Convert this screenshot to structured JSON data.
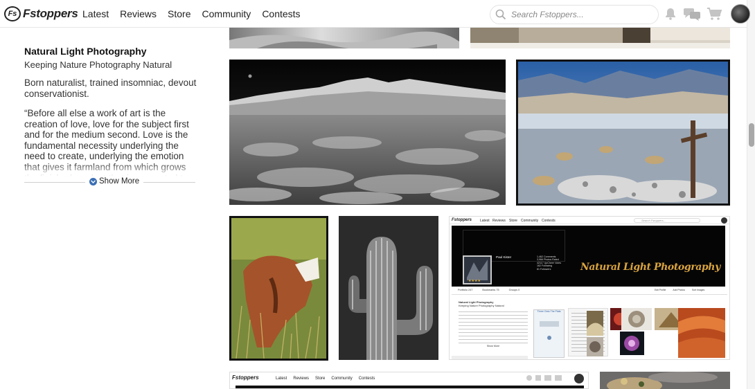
{
  "header": {
    "logo_mark": "Fs",
    "logo_text": "Fstoppers",
    "nav": [
      "Latest",
      "Reviews",
      "Store",
      "Community",
      "Contests"
    ],
    "search_placeholder": "Search Fstoppers..."
  },
  "profile": {
    "title": "Natural Light Photography",
    "subtitle": "Keeping Nature Photography Natural",
    "bio": "Born naturalist, trained insomniac, devout conservationist.",
    "quote": "“Before all else a work of art is the creation of love, love for the subject first and for the medium second. Love is the fundamental necessity underlying the need to create, underlying the emotion that gives it farmland from which grows the finished product that is presented to the world. Love is the",
    "show_more": "Show More"
  },
  "icons": {
    "bell": "bell-icon",
    "chat": "chat-icon",
    "cart": "cart-icon",
    "search": "search-icon"
  },
  "thumb_a": {
    "nav": [
      "Latest",
      "Reviews",
      "Store",
      "Community",
      "Contests"
    ],
    "search_placeholder": "Search Fstoppers...",
    "user": "Paul Kister",
    "stats": [
      "1,462 Comments",
      "3,966 Photos Rated",
      "42117 UpCheer Votes",
      "162 Following",
      "81 Followers"
    ],
    "banner": "Natural Light Photography",
    "tabs": [
      "Portfolio 247",
      "Bookmarks 75",
      "Groups 0"
    ],
    "actions": [
      "Edit Profile",
      "Add Photos",
      "Sort Images"
    ],
    "title": "Natural Light Photography",
    "subtitle": "Keeping Nature Photography Natural",
    "show_more": "Show More",
    "photo_caption": "Three Onto The Flats"
  },
  "thumb_b": {
    "nav": [
      "Latest",
      "Reviews",
      "Store",
      "Community",
      "Contests"
    ]
  }
}
